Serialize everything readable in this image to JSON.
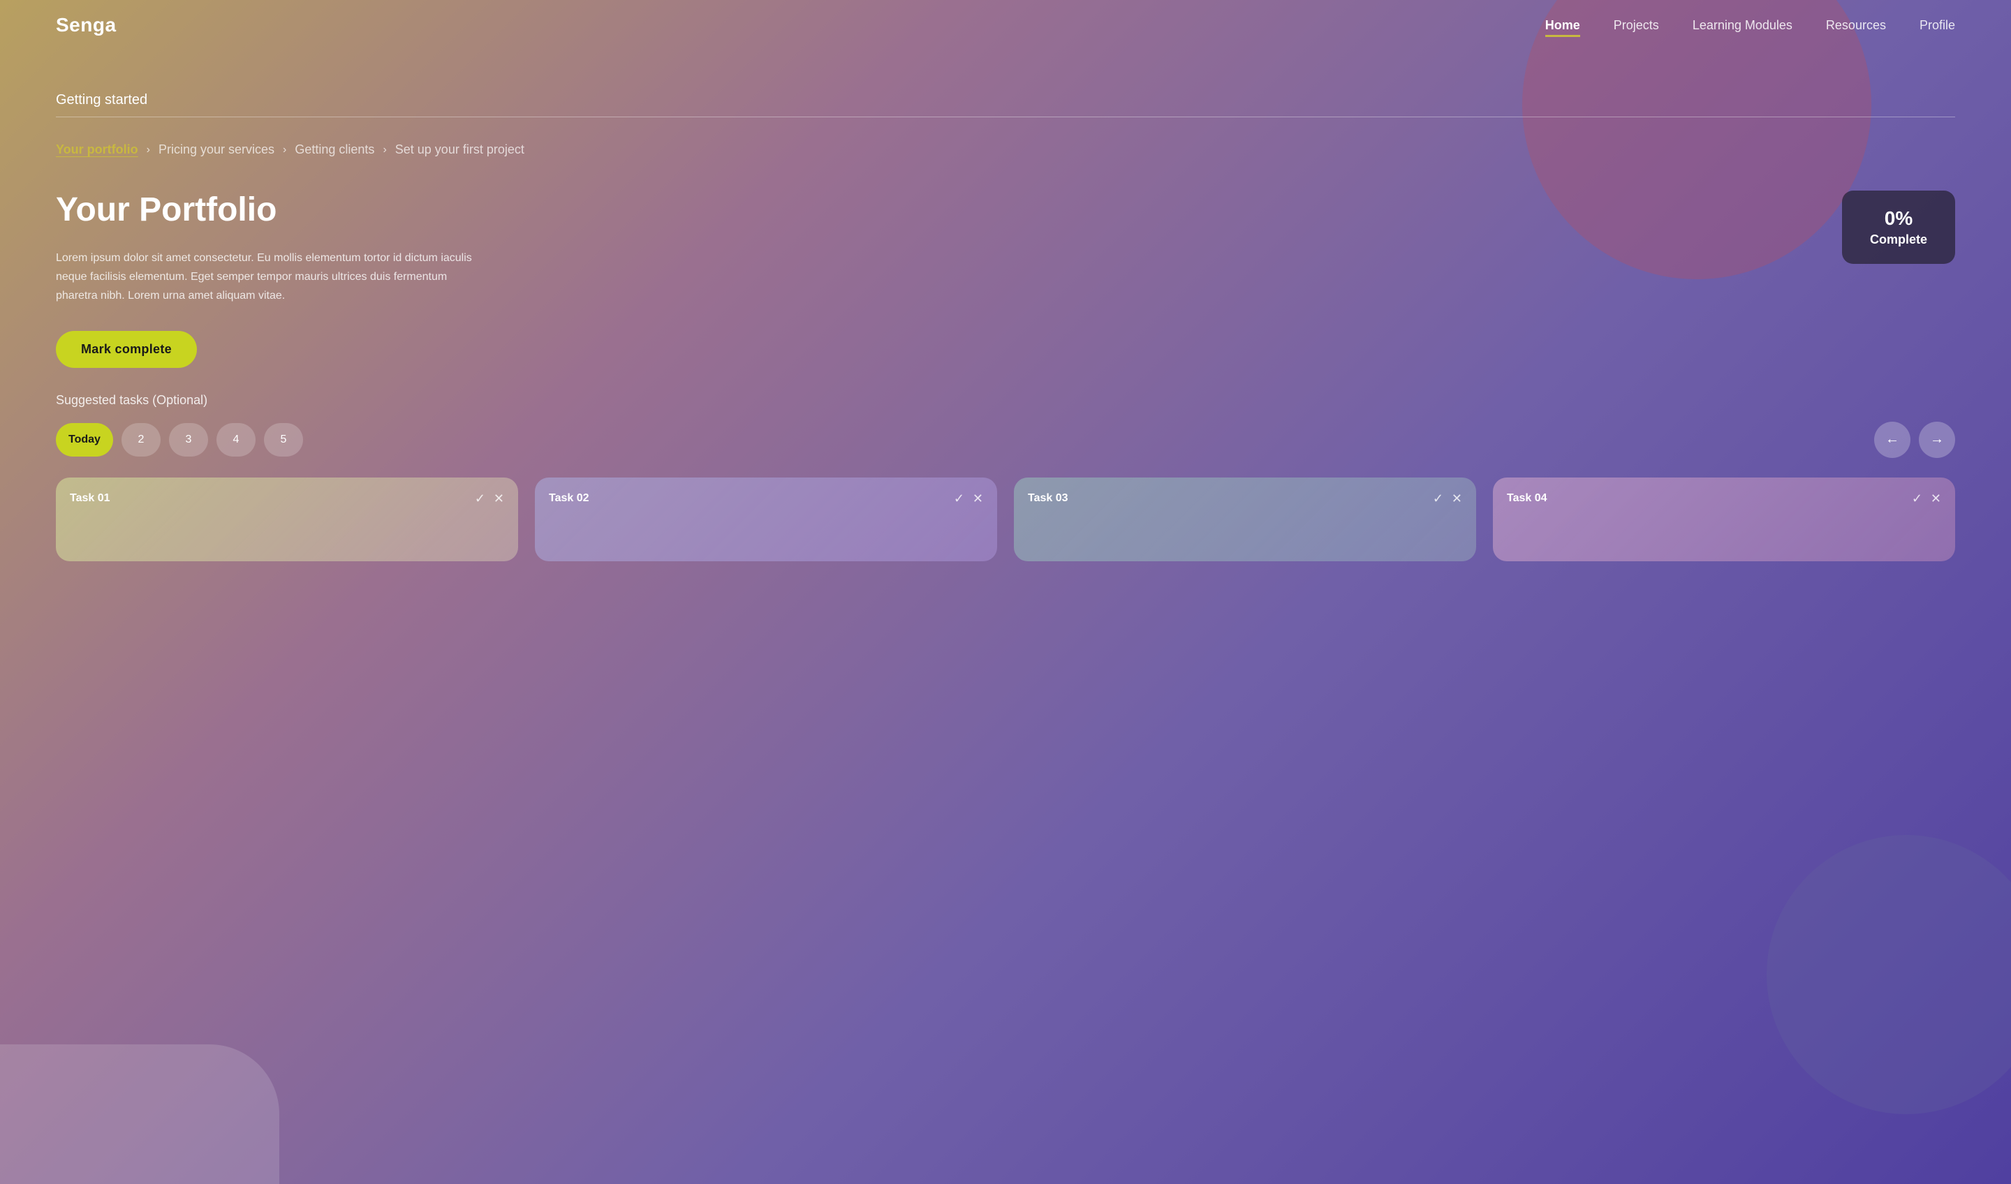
{
  "app": {
    "logo": "Senga"
  },
  "nav": {
    "links": [
      {
        "id": "home",
        "label": "Home",
        "active": true
      },
      {
        "id": "projects",
        "label": "Projects",
        "active": false
      },
      {
        "id": "learning-modules",
        "label": "Learning Modules",
        "active": false
      },
      {
        "id": "resources",
        "label": "Resources",
        "active": false
      },
      {
        "id": "profile",
        "label": "Profile",
        "active": false
      }
    ]
  },
  "getting_started": {
    "section_title": "Getting started"
  },
  "breadcrumb": {
    "steps": [
      {
        "id": "your-portfolio",
        "label": "Your portfolio",
        "active": true
      },
      {
        "id": "pricing-services",
        "label": "Pricing your services",
        "active": false
      },
      {
        "id": "getting-clients",
        "label": "Getting clients",
        "active": false
      },
      {
        "id": "first-project",
        "label": "Set up your first project",
        "active": false
      }
    ]
  },
  "portfolio": {
    "title": "Your Portfolio",
    "description": "Lorem ipsum dolor sit amet consectetur. Eu mollis elementum tortor id dictum iaculis neque facilisis elementum. Eget semper tempor mauris ultrices duis fermentum pharetra nibh. Lorem urna amet aliquam vitae.",
    "mark_complete_label": "Mark complete",
    "progress": {
      "percent": "0%",
      "label": "Complete"
    }
  },
  "suggested_tasks": {
    "section_title": "Suggested tasks (Optional)",
    "day_tabs": [
      {
        "id": "today",
        "label": "Today",
        "active": true
      },
      {
        "id": "2",
        "label": "2",
        "active": false
      },
      {
        "id": "3",
        "label": "3",
        "active": false
      },
      {
        "id": "4",
        "label": "4",
        "active": false
      },
      {
        "id": "5",
        "label": "5",
        "active": false
      }
    ],
    "nav_arrows": {
      "prev": "←",
      "next": "→"
    },
    "tasks": [
      {
        "id": "task-01",
        "label": "Task 01"
      },
      {
        "id": "task-02",
        "label": "Task 02"
      },
      {
        "id": "task-03",
        "label": "Task 03"
      },
      {
        "id": "task-04",
        "label": "Task 04"
      }
    ]
  },
  "icons": {
    "chevron_right": "›",
    "check": "✓",
    "close": "✕",
    "arrow_left": "←",
    "arrow_right": "→"
  }
}
